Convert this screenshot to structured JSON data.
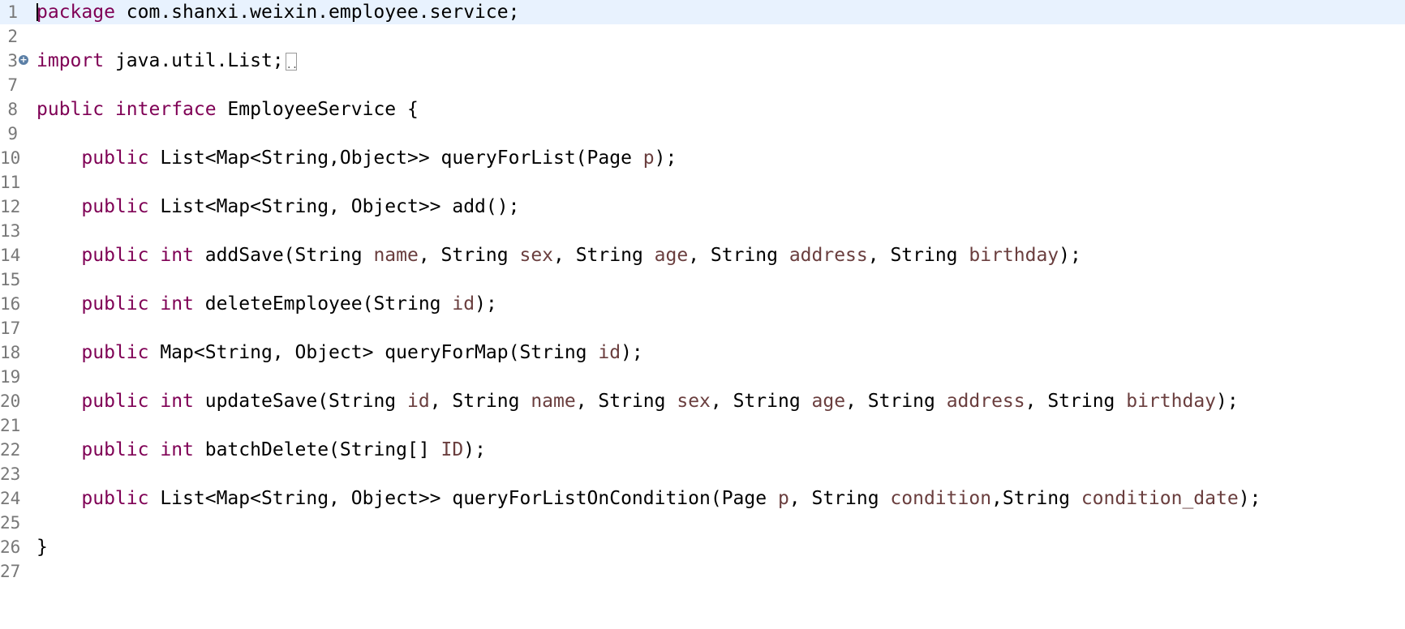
{
  "editor": {
    "current_line": 1,
    "fold_icon": "fold-plus-icon",
    "colors": {
      "keyword": "#7f0055",
      "parameter": "#6a3e3e",
      "line_number": "#787878",
      "current_line_bg": "#e8f2fe"
    },
    "lines": [
      {
        "n": "1",
        "parts": [
          [
            "kw",
            "package"
          ],
          [
            "t",
            " com.shanxi.weixin.employee.service;"
          ]
        ]
      },
      {
        "n": "2",
        "parts": []
      },
      {
        "n": "3",
        "fold": true,
        "parts": [
          [
            "kw",
            "import"
          ],
          [
            "t",
            " java.util.List;"
          ]
        ]
      },
      {
        "n": "7",
        "parts": []
      },
      {
        "n": "8",
        "parts": [
          [
            "kw",
            "public"
          ],
          [
            "t",
            " "
          ],
          [
            "kw",
            "interface"
          ],
          [
            "t",
            " EmployeeService {"
          ]
        ]
      },
      {
        "n": "9",
        "parts": []
      },
      {
        "n": "10",
        "parts": [
          [
            "t",
            "    "
          ],
          [
            "kw",
            "public"
          ],
          [
            "t",
            " List<Map<String,Object>> queryForList(Page "
          ],
          [
            "p",
            "p"
          ],
          [
            "t",
            ");"
          ]
        ]
      },
      {
        "n": "11",
        "parts": []
      },
      {
        "n": "12",
        "parts": [
          [
            "t",
            "    "
          ],
          [
            "kw",
            "public"
          ],
          [
            "t",
            " List<Map<String, Object>> add();"
          ]
        ]
      },
      {
        "n": "13",
        "parts": []
      },
      {
        "n": "14",
        "parts": [
          [
            "t",
            "    "
          ],
          [
            "kw",
            "public"
          ],
          [
            "t",
            " "
          ],
          [
            "kw",
            "int"
          ],
          [
            "t",
            " addSave(String "
          ],
          [
            "p",
            "name"
          ],
          [
            "t",
            ", String "
          ],
          [
            "p",
            "sex"
          ],
          [
            "t",
            ", String "
          ],
          [
            "p",
            "age"
          ],
          [
            "t",
            ", String "
          ],
          [
            "p",
            "address"
          ],
          [
            "t",
            ", String "
          ],
          [
            "p",
            "birthday"
          ],
          [
            "t",
            ");"
          ]
        ]
      },
      {
        "n": "15",
        "parts": []
      },
      {
        "n": "16",
        "parts": [
          [
            "t",
            "    "
          ],
          [
            "kw",
            "public"
          ],
          [
            "t",
            " "
          ],
          [
            "kw",
            "int"
          ],
          [
            "t",
            " deleteEmployee(String "
          ],
          [
            "p",
            "id"
          ],
          [
            "t",
            ");"
          ]
        ]
      },
      {
        "n": "17",
        "parts": []
      },
      {
        "n": "18",
        "parts": [
          [
            "t",
            "    "
          ],
          [
            "kw",
            "public"
          ],
          [
            "t",
            " Map<String, Object> queryForMap(String "
          ],
          [
            "p",
            "id"
          ],
          [
            "t",
            ");"
          ]
        ]
      },
      {
        "n": "19",
        "parts": []
      },
      {
        "n": "20",
        "parts": [
          [
            "t",
            "    "
          ],
          [
            "kw",
            "public"
          ],
          [
            "t",
            " "
          ],
          [
            "kw",
            "int"
          ],
          [
            "t",
            " updateSave(String "
          ],
          [
            "p",
            "id"
          ],
          [
            "t",
            ", String "
          ],
          [
            "p",
            "name"
          ],
          [
            "t",
            ", String "
          ],
          [
            "p",
            "sex"
          ],
          [
            "t",
            ", String "
          ],
          [
            "p",
            "age"
          ],
          [
            "t",
            ", String "
          ],
          [
            "p",
            "address"
          ],
          [
            "t",
            ", String "
          ],
          [
            "p",
            "birthday"
          ],
          [
            "t",
            ");"
          ]
        ]
      },
      {
        "n": "21",
        "parts": []
      },
      {
        "n": "22",
        "parts": [
          [
            "t",
            "    "
          ],
          [
            "kw",
            "public"
          ],
          [
            "t",
            " "
          ],
          [
            "kw",
            "int"
          ],
          [
            "t",
            " batchDelete(String[] "
          ],
          [
            "p",
            "ID"
          ],
          [
            "t",
            ");"
          ]
        ]
      },
      {
        "n": "23",
        "parts": []
      },
      {
        "n": "24",
        "parts": [
          [
            "t",
            "    "
          ],
          [
            "kw",
            "public"
          ],
          [
            "t",
            " List<Map<String, Object>> queryForListOnCondition(Page "
          ],
          [
            "p",
            "p"
          ],
          [
            "t",
            ", String "
          ],
          [
            "p",
            "condition"
          ],
          [
            "t",
            ",String "
          ],
          [
            "p",
            "condition_date"
          ],
          [
            "t",
            ");"
          ]
        ]
      },
      {
        "n": "25",
        "parts": []
      },
      {
        "n": "26",
        "parts": [
          [
            "t",
            "}"
          ]
        ]
      },
      {
        "n": "27",
        "parts": []
      }
    ]
  }
}
